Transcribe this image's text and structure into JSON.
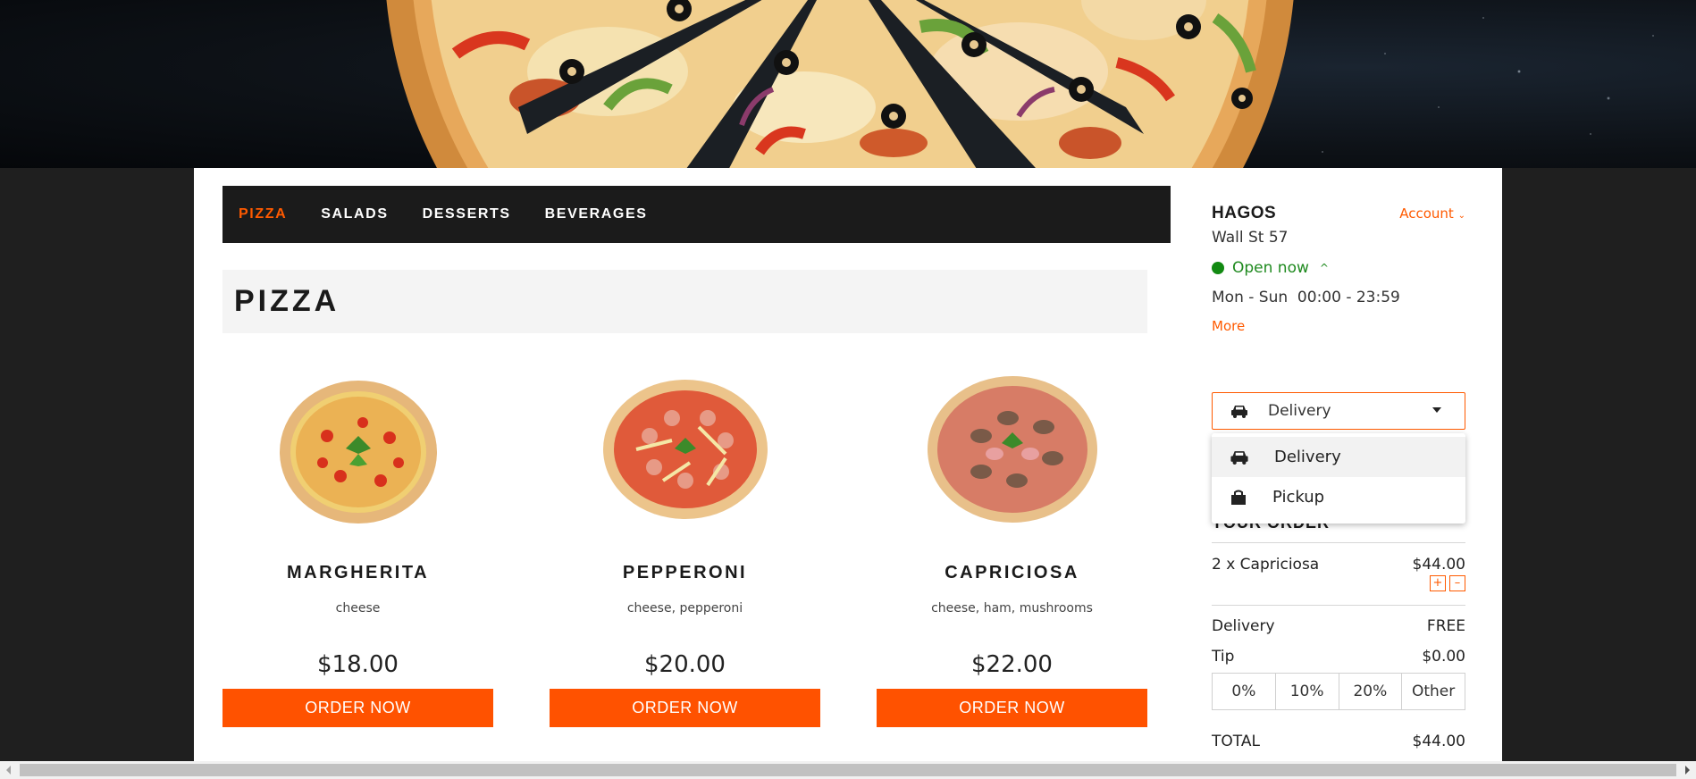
{
  "nav": {
    "tabs": [
      {
        "label": "PIZZA",
        "active": true
      },
      {
        "label": "SALADS"
      },
      {
        "label": "DESSERTS"
      },
      {
        "label": "BEVERAGES"
      }
    ]
  },
  "section": {
    "title": "PIZZA"
  },
  "products": [
    {
      "name": "MARGHERITA",
      "description": "cheese",
      "price": "$18.00",
      "button": "ORDER NOW"
    },
    {
      "name": "PEPPERONI",
      "description": "cheese, pepperoni",
      "price": "$20.00",
      "button": "ORDER NOW"
    },
    {
      "name": "CAPRICIOSA",
      "description": "cheese, ham, mushrooms",
      "price": "$22.00",
      "button": "ORDER NOW"
    }
  ],
  "store": {
    "name": "HAGOS",
    "account_label": "Account",
    "address": "Wall St 57",
    "status": "Open now",
    "hours": "Mon - Sun  00:00 - 23:59",
    "more_label": "More"
  },
  "order_type": {
    "selected": "Delivery",
    "options": [
      {
        "label": "Delivery",
        "icon": "car-icon"
      },
      {
        "label": "Pickup",
        "icon": "bag-icon"
      }
    ]
  },
  "order": {
    "title": "YOUR ORDER",
    "items": [
      {
        "label": "2 x Capriciosa",
        "price": "$44.00"
      }
    ],
    "plus": "+",
    "minus": "–",
    "delivery_label": "Delivery",
    "delivery_value": "FREE",
    "tip_label": "Tip",
    "tip_value": "$0.00",
    "tip_options": [
      "0%",
      "10%",
      "20%",
      "Other"
    ],
    "total_label": "TOTAL",
    "total_value": "$44.00"
  },
  "colors": {
    "accent": "#ff5200",
    "open_green": "#128a12",
    "nav_bg": "#1b1b1b",
    "page_bg": "#1f1f1f"
  }
}
